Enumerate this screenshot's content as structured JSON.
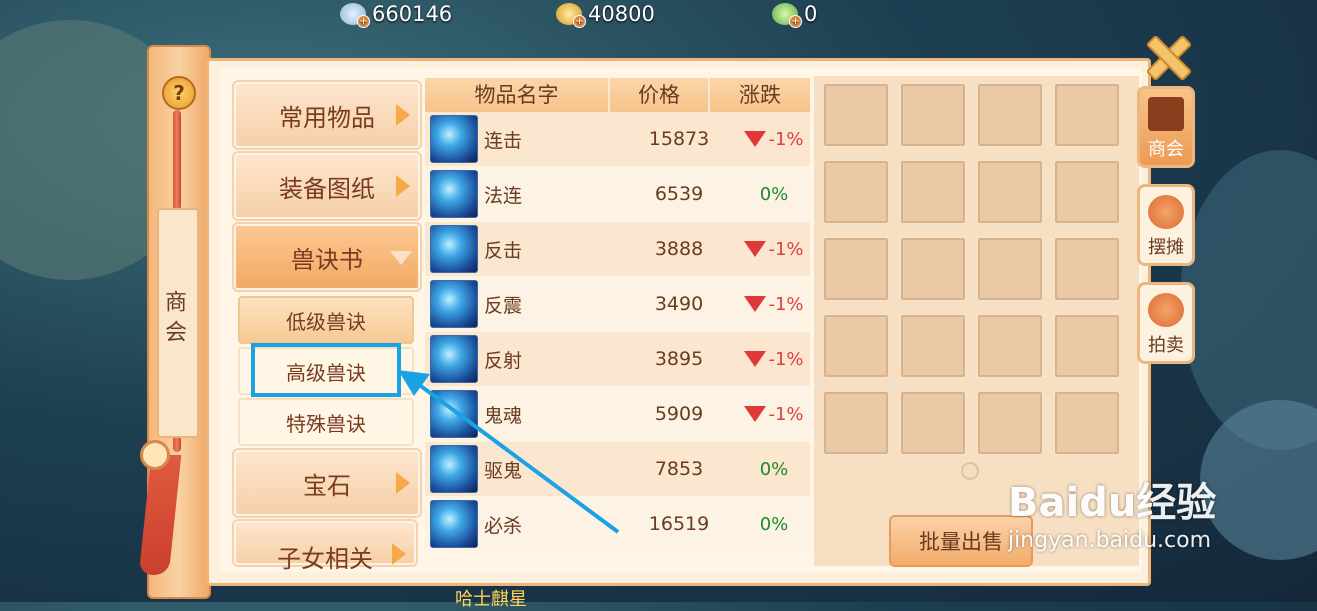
{
  "currencies": [
    {
      "icon": "silver-coin-icon",
      "value": "660146"
    },
    {
      "icon": "gold-coin-icon",
      "value": "40800"
    },
    {
      "icon": "jade-coin-icon",
      "value": "0"
    }
  ],
  "left_rail": {
    "help": "?",
    "label": "商会"
  },
  "categories": [
    {
      "label": "常用物品",
      "state": "collapsed"
    },
    {
      "label": "装备图纸",
      "state": "collapsed"
    },
    {
      "label": "兽诀书",
      "state": "expanded"
    },
    {
      "label": "宝石",
      "state": "collapsed"
    },
    {
      "label": "子女相关",
      "state": "collapsed"
    }
  ],
  "subcategories": [
    {
      "label": "低级兽诀",
      "selected": true
    },
    {
      "label": "高级兽诀",
      "selected": false
    },
    {
      "label": "特殊兽诀",
      "selected": false
    }
  ],
  "table": {
    "headers": [
      "物品名字",
      "价格",
      "涨跌"
    ],
    "rows": [
      {
        "name": "连击",
        "price": "15873",
        "change": "-1%",
        "trend": "down"
      },
      {
        "name": "法连",
        "price": "6539",
        "change": "0%",
        "trend": "flat"
      },
      {
        "name": "反击",
        "price": "3888",
        "change": "-1%",
        "trend": "down"
      },
      {
        "name": "反震",
        "price": "3490",
        "change": "-1%",
        "trend": "down"
      },
      {
        "name": "反射",
        "price": "3895",
        "change": "-1%",
        "trend": "down"
      },
      {
        "name": "鬼魂",
        "price": "5909",
        "change": "-1%",
        "trend": "down"
      },
      {
        "name": "驱鬼",
        "price": "7853",
        "change": "0%",
        "trend": "flat"
      },
      {
        "name": "必杀",
        "price": "16519",
        "change": "0%",
        "trend": "flat"
      }
    ]
  },
  "batch_sell_button": "批量出售",
  "right_tabs": [
    {
      "label": "商会",
      "active": true
    },
    {
      "label": "摆摊",
      "active": false
    },
    {
      "label": "拍卖",
      "active": false
    }
  ],
  "watermark": {
    "logo": "Baidu经验",
    "url": "jingyan.baidu.com"
  },
  "bottom_text": "哈士麒星",
  "colors": {
    "accent": "#f3ac6b",
    "highlight": "#1aa2e4",
    "down": "#e04040",
    "flat": "#1e8a2e"
  }
}
